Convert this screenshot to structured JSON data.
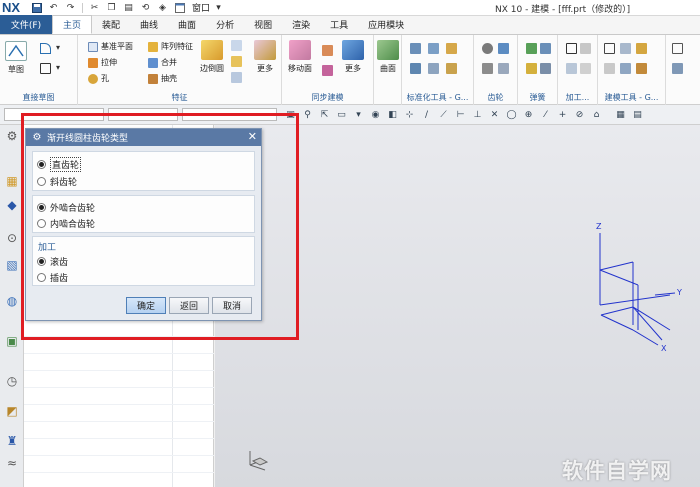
{
  "app": {
    "logo": "NX",
    "window_menu": "窗口",
    "title": "NX 10 - 建模 - [fff.prt（修改的）]"
  },
  "menu": {
    "file": "文件(F)",
    "tabs": [
      "主页",
      "装配",
      "曲线",
      "曲面",
      "分析",
      "视图",
      "渲染",
      "工具",
      "应用模块"
    ],
    "active_tab": "主页"
  },
  "ribbon": {
    "sketch": {
      "button": "草图",
      "group": "直接草图"
    },
    "feature": {
      "datum_plane": "基准平面",
      "array_feature": "阵列特征",
      "extrude": "拉伸",
      "combine": "合并",
      "hole": "孔",
      "shell": "抽壳",
      "edge_blend": "边倒圆",
      "more": "更多",
      "group": "特征"
    },
    "sync": {
      "move_face": "移动面",
      "more": "更多",
      "group": "同步建模"
    },
    "surface": {
      "button": "曲面"
    },
    "std_tools": {
      "group": "标准化工具 - G..."
    },
    "gear": {
      "group": "齿轮"
    },
    "spring": {
      "group": "弹簧"
    },
    "machining": {
      "group": "加工..."
    },
    "build_tools": {
      "group": "建模工具 - G..."
    }
  },
  "dialog": {
    "title": "渐开线圆柱齿轮类型",
    "gear_type": {
      "options": [
        "直齿轮",
        "斜齿轮"
      ],
      "selected": 0
    },
    "mesh_type": {
      "options": [
        "外啮合齿轮",
        "内啮合齿轮"
      ],
      "selected": 0
    },
    "machining": {
      "title": "加工",
      "options": [
        "滚齿",
        "插齿"
      ],
      "selected": 0
    },
    "buttons": {
      "ok": "确定",
      "back": "返回",
      "cancel": "取消"
    }
  },
  "axes": {
    "z": "Z",
    "y": "Y",
    "x": "X"
  },
  "watermark": "软件自学网",
  "colors": {
    "accent": "#2b5d96",
    "highlight": "#e01d23",
    "axis": "#2233cc"
  }
}
